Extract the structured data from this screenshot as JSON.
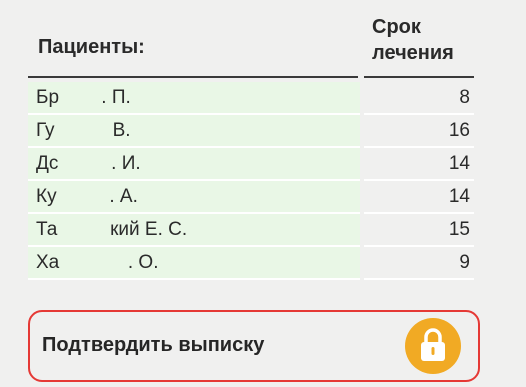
{
  "header": {
    "patients_label": "Пациенты:",
    "term_label_line1": "Срок",
    "term_label_line2": "лечения"
  },
  "patients": [
    {
      "name": "Бр        . П.",
      "term": "8"
    },
    {
      "name": "Гу           В.",
      "term": "16"
    },
    {
      "name": "Дс          . И.",
      "term": "14"
    },
    {
      "name": "Ку          . А.",
      "term": "14"
    },
    {
      "name": "Та          кий Е. С.",
      "term": "15"
    },
    {
      "name": "Ха             . О.",
      "term": "9"
    }
  ],
  "confirm": {
    "label": "Подтвердить выписку",
    "icon": "lock-icon"
  },
  "colors": {
    "row_bg": "#e9f7e6",
    "confirm_border": "#e53935",
    "lock_button": "#f1aa24"
  }
}
